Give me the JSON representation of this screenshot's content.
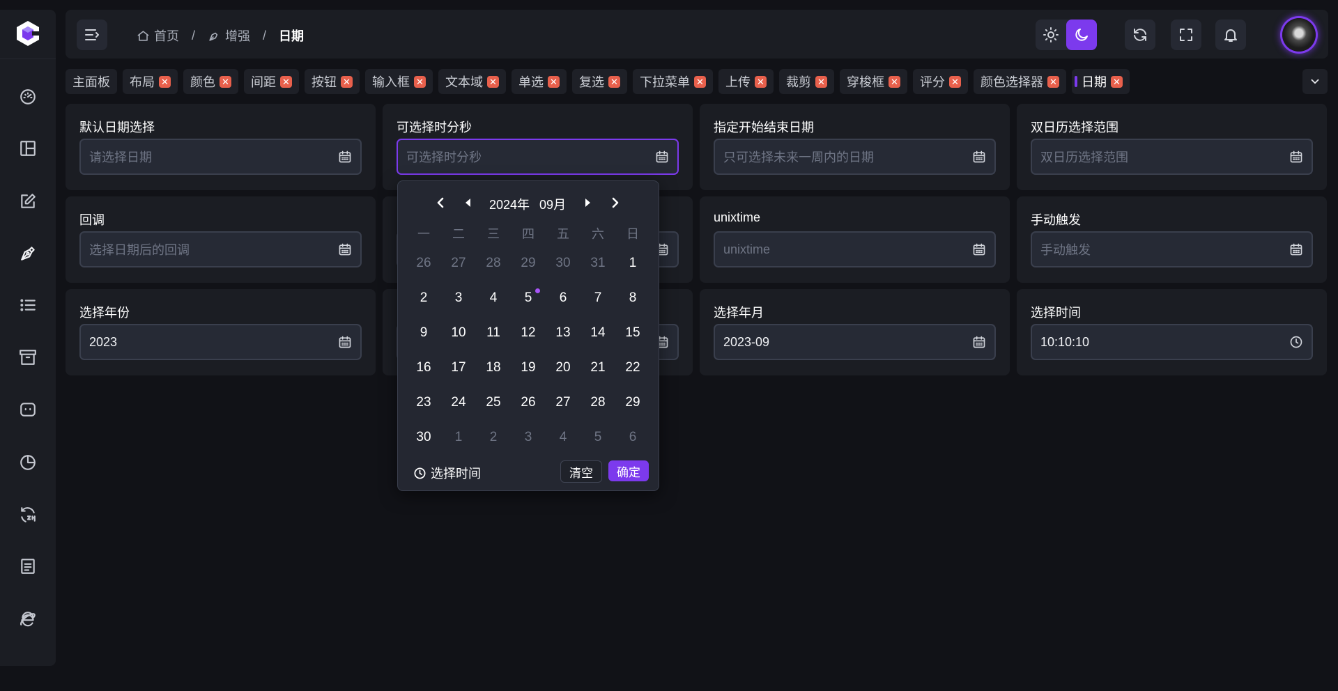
{
  "header": {
    "breadcrumb": [
      {
        "label": "首页",
        "icon": "home-icon"
      },
      {
        "label": "增强",
        "icon": "pen-nib-icon"
      },
      {
        "label": "日期"
      }
    ]
  },
  "tabs": [
    {
      "label": "主面板",
      "closable": false
    },
    {
      "label": "布局",
      "closable": true
    },
    {
      "label": "颜色",
      "closable": true
    },
    {
      "label": "间距",
      "closable": true
    },
    {
      "label": "按钮",
      "closable": true
    },
    {
      "label": "输入框",
      "closable": true
    },
    {
      "label": "文本域",
      "closable": true
    },
    {
      "label": "单选",
      "closable": true
    },
    {
      "label": "复选",
      "closable": true
    },
    {
      "label": "下拉菜单",
      "closable": true
    },
    {
      "label": "上传",
      "closable": true
    },
    {
      "label": "裁剪",
      "closable": true
    },
    {
      "label": "穿梭框",
      "closable": true
    },
    {
      "label": "评分",
      "closable": true
    },
    {
      "label": "颜色选择器",
      "closable": true
    },
    {
      "label": "日期",
      "closable": true,
      "active": true
    }
  ],
  "cards": [
    {
      "label": "默认日期选择",
      "placeholder": "请选择日期",
      "value": "",
      "icon": "calendar-icon"
    },
    {
      "label": "可选择时分秒",
      "placeholder": "可选择时分秒",
      "value": "",
      "icon": "calendar-icon",
      "focused": true
    },
    {
      "label": "指定开始结束日期",
      "placeholder": "只可选择未来一周内的日期",
      "value": "",
      "icon": "calendar-icon"
    },
    {
      "label": "双日历选择范围",
      "placeholder": "双日历选择范围",
      "value": "",
      "icon": "calendar-icon"
    },
    {
      "label": "回调",
      "placeholder": "选择日期后的回调",
      "value": "",
      "icon": "calendar-icon"
    },
    {
      "label": "",
      "placeholder": "",
      "value": "",
      "icon": "calendar-icon",
      "hidden_by_popup": true
    },
    {
      "label": "unixtime",
      "placeholder": "unixtime",
      "value": "",
      "icon": "calendar-icon"
    },
    {
      "label": "手动触发",
      "placeholder": "手动触发",
      "value": "",
      "icon": "calendar-icon"
    },
    {
      "label": "选择年份",
      "placeholder": "",
      "value": "2023",
      "icon": "calendar-icon"
    },
    {
      "label": "",
      "placeholder": "",
      "value": "",
      "icon": "calendar-icon",
      "hidden_by_popup": true
    },
    {
      "label": "选择年月",
      "placeholder": "",
      "value": "2023-09",
      "icon": "calendar-icon"
    },
    {
      "label": "选择时间",
      "placeholder": "",
      "value": "10:10:10",
      "icon": "clock-icon"
    }
  ],
  "datepicker": {
    "year_label": "2024年",
    "month_label": "09月",
    "weekdays": [
      "一",
      "二",
      "三",
      "四",
      "五",
      "六",
      "日"
    ],
    "days": [
      {
        "d": "26",
        "m": true
      },
      {
        "d": "27",
        "m": true
      },
      {
        "d": "28",
        "m": true
      },
      {
        "d": "29",
        "m": true
      },
      {
        "d": "30",
        "m": true
      },
      {
        "d": "31",
        "m": true
      },
      {
        "d": "1"
      },
      {
        "d": "2"
      },
      {
        "d": "3"
      },
      {
        "d": "4"
      },
      {
        "d": "5",
        "today": true
      },
      {
        "d": "6"
      },
      {
        "d": "7"
      },
      {
        "d": "8"
      },
      {
        "d": "9"
      },
      {
        "d": "10"
      },
      {
        "d": "11"
      },
      {
        "d": "12"
      },
      {
        "d": "13"
      },
      {
        "d": "14"
      },
      {
        "d": "15"
      },
      {
        "d": "16"
      },
      {
        "d": "17"
      },
      {
        "d": "18"
      },
      {
        "d": "19"
      },
      {
        "d": "20"
      },
      {
        "d": "21"
      },
      {
        "d": "22"
      },
      {
        "d": "23"
      },
      {
        "d": "24"
      },
      {
        "d": "25"
      },
      {
        "d": "26"
      },
      {
        "d": "27"
      },
      {
        "d": "28"
      },
      {
        "d": "29"
      },
      {
        "d": "30"
      },
      {
        "d": "1",
        "m": true
      },
      {
        "d": "2",
        "m": true
      },
      {
        "d": "3",
        "m": true
      },
      {
        "d": "4",
        "m": true
      },
      {
        "d": "5",
        "m": true
      },
      {
        "d": "6",
        "m": true
      }
    ],
    "select_time_label": "选择时间",
    "clear_label": "清空",
    "confirm_label": "确定"
  },
  "colors": {
    "accent": "#7c3aed",
    "close_badge": "#e8604c",
    "background": "#111217",
    "panel": "#1b1d23"
  }
}
